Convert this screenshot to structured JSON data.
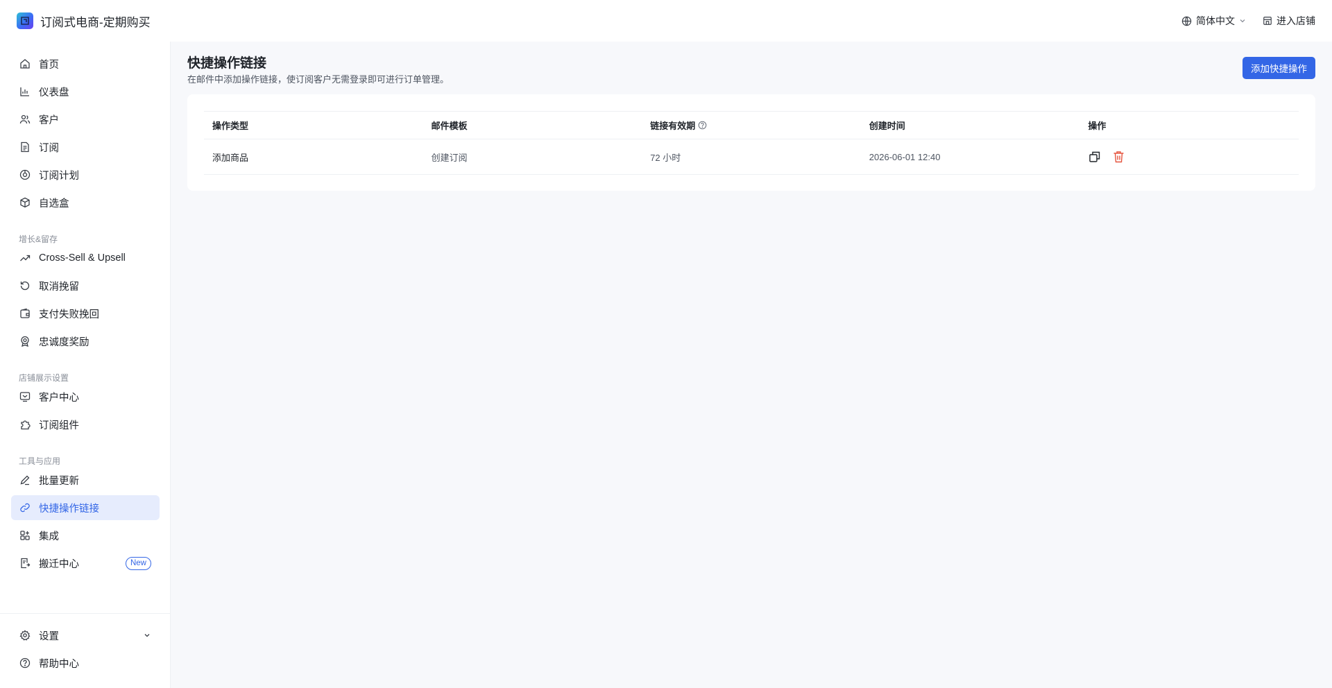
{
  "app": {
    "title": "订阅式电商-定期购买"
  },
  "topbar": {
    "language": "简体中文",
    "enter_store": "进入店铺"
  },
  "sidebar": {
    "items": [
      {
        "label": "首页",
        "icon": "home-icon"
      },
      {
        "label": "仪表盘",
        "icon": "chart-icon"
      },
      {
        "label": "客户",
        "icon": "users-icon"
      },
      {
        "label": "订阅",
        "icon": "document-icon"
      },
      {
        "label": "订阅计划",
        "icon": "plan-icon"
      },
      {
        "label": "自选盒",
        "icon": "box-icon"
      }
    ],
    "section_growth": "增长&留存",
    "growth_items": [
      {
        "label": "Cross-Sell & Upsell",
        "icon": "trending-up-icon"
      },
      {
        "label": "取消挽留",
        "icon": "undo-icon"
      },
      {
        "label": "支付失败挽回",
        "icon": "wallet-icon"
      },
      {
        "label": "忠诚度奖励",
        "icon": "award-icon"
      }
    ],
    "section_store": "店铺展示设置",
    "store_items": [
      {
        "label": "客户中心",
        "icon": "monitor-icon"
      },
      {
        "label": "订阅组件",
        "icon": "puzzle-icon"
      }
    ],
    "section_tools": "工具与应用",
    "tools_items": [
      {
        "label": "批量更新",
        "icon": "edit-icon"
      },
      {
        "label": "快捷操作链接",
        "icon": "link-icon",
        "active": true
      },
      {
        "label": "集成",
        "icon": "apps-icon"
      },
      {
        "label": "搬迁中心",
        "icon": "migrate-icon",
        "badge": "New"
      }
    ],
    "bottom_items": [
      {
        "label": "设置",
        "icon": "gear-icon"
      },
      {
        "label": "帮助中心",
        "icon": "help-icon"
      }
    ]
  },
  "main": {
    "title": "快捷操作链接",
    "description": "在邮件中添加操作链接，使订阅客户无需登录即可进行订单管理。",
    "add_button": "添加快捷操作",
    "table": {
      "headers": [
        "操作类型",
        "邮件模板",
        "链接有效期",
        "创建时间",
        "操作"
      ],
      "rows": [
        {
          "type": "添加商品",
          "template": "创建订阅",
          "validity": "72 小时",
          "created": "2026-06-01 12:40"
        }
      ]
    }
  },
  "colors": {
    "accent": "#3366e6",
    "danger": "#e5533d",
    "active_bg": "#e6ecfd"
  }
}
